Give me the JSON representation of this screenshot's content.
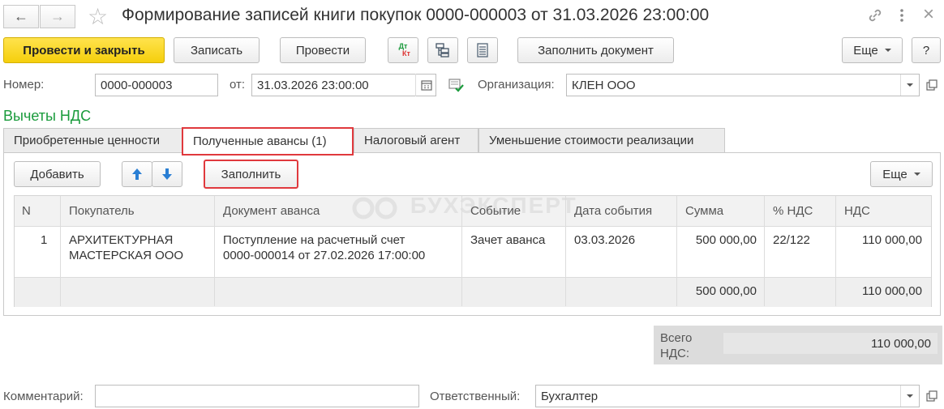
{
  "window": {
    "title": "Формирование записей книги покупок 0000-000003 от 31.03.2026 23:00:00"
  },
  "toolbar": {
    "post_close": "Провести и закрыть",
    "save": "Записать",
    "post": "Провести",
    "dtkt_top": "Дт",
    "dtkt_bottom": "Кт",
    "fill_document": "Заполнить документ",
    "more": "Еще",
    "help": "?"
  },
  "header": {
    "number_label": "Номер:",
    "number_value": "0000-000003",
    "date_label": "от:",
    "date_value": "31.03.2026 23:00:00",
    "org_label": "Организация:",
    "org_value": "КЛЕН ООО"
  },
  "section_title": "Вычеты НДС",
  "tabs": [
    {
      "label": "Приобретенные ценности"
    },
    {
      "label": "Полученные авансы (1)"
    },
    {
      "label": "Налоговый агент"
    },
    {
      "label": "Уменьшение стоимости реализации"
    }
  ],
  "tab_toolbar": {
    "add": "Добавить",
    "fill": "Заполнить",
    "more": "Еще"
  },
  "watermark": "БУХЭКСПЕРТ",
  "table": {
    "columns": [
      "N",
      "Покупатель",
      "Документ аванса",
      "Событие",
      "Дата события",
      "Сумма",
      "% НДС",
      "НДС"
    ],
    "rows": [
      {
        "n": "1",
        "buyer_line1": "АРХИТЕКТУРНАЯ",
        "buyer_line2": "МАСТЕРСКАЯ ООО",
        "doc_line1": "Поступление на расчетный счет",
        "doc_line2": "0000-000014 от 27.02.2026 17:00:00",
        "event": "Зачет аванса",
        "date": "03.03.2026",
        "sum": "500 000,00",
        "vat_rate": "22/122",
        "vat": "110 000,00"
      }
    ],
    "footer": {
      "sum": "500 000,00",
      "vat": "110 000,00"
    }
  },
  "total": {
    "label_line1": "Всего",
    "label_line2": "НДС:",
    "value": "110 000,00"
  },
  "footer": {
    "comment_label": "Комментарий:",
    "comment_value": "",
    "responsible_label": "Ответственный:",
    "responsible_value": "Бухгалтер"
  },
  "colors": {
    "primary_button": "#f5cf0c",
    "section_title": "#1a9b3c",
    "highlight": "#e0393d",
    "arrow_blue": "#2a7fd4"
  }
}
